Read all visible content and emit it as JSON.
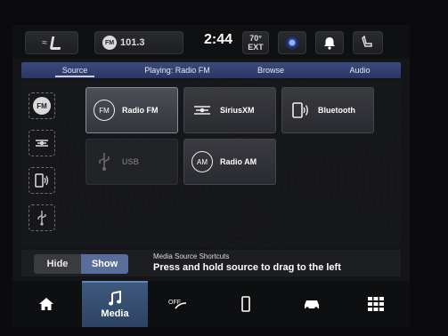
{
  "topbar": {
    "radio_station": "101.3",
    "radio_badge": "FM",
    "time": "2:44",
    "temperature": "70°",
    "temperature_sub": "EXT"
  },
  "tabs": [
    {
      "label": "Source",
      "active": true
    },
    {
      "label": "Playing: Radio FM",
      "active": false
    },
    {
      "label": "Browse",
      "active": false
    },
    {
      "label": "Audio",
      "active": false
    }
  ],
  "sources": [
    {
      "label": "Radio FM",
      "icon": "fm-icon",
      "badge": "FM",
      "state": "active"
    },
    {
      "label": "SiriusXM",
      "icon": "siriusxm-icon",
      "state": "normal"
    },
    {
      "label": "Bluetooth",
      "icon": "bluetooth-phone-icon",
      "state": "normal"
    },
    {
      "label": "USB",
      "icon": "usb-icon",
      "state": "disabled"
    },
    {
      "label": "Radio AM",
      "icon": "am-icon",
      "badge": "AM",
      "state": "normal"
    }
  ],
  "shortcut_badge": "FM",
  "hide_show": {
    "hide_label": "Hide",
    "show_label": "Show",
    "selected": "Show"
  },
  "hint": {
    "title": "Media Source Shortcuts",
    "body": "Press and hold source to drag to the left"
  },
  "bottom_nav": [
    {
      "icon": "home-icon",
      "label": ""
    },
    {
      "icon": "music-note-icon",
      "label": "Media",
      "active": true
    },
    {
      "icon": "climate-icon",
      "label": ""
    },
    {
      "icon": "phone-icon",
      "label": ""
    },
    {
      "icon": "vehicle-icon",
      "label": ""
    },
    {
      "icon": "apps-grid-icon",
      "label": ""
    }
  ],
  "colors": {
    "accent": "#2f3f74",
    "active_nav": "#3f5a7e"
  }
}
